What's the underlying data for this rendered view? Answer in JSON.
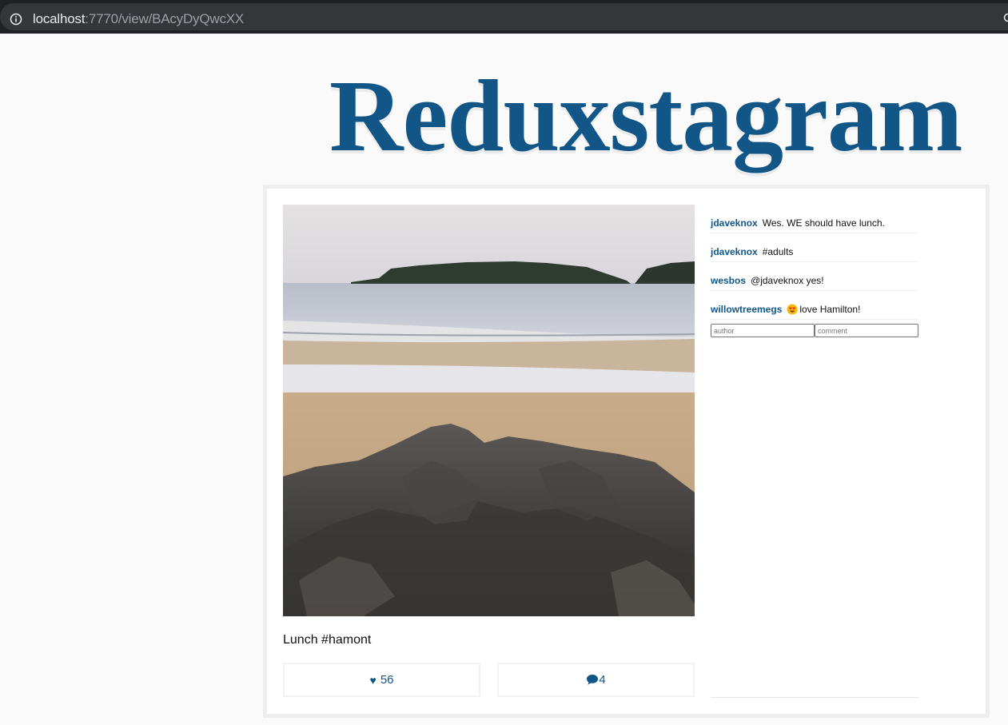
{
  "browser": {
    "url_host": "localhost",
    "url_path": ":7770/view/BAcyDyQwcXX",
    "icon": "info-icon"
  },
  "page": {
    "title": "Reduxstagram",
    "title_color": "#125688"
  },
  "post": {
    "caption": "Lunch #hamont",
    "likes": "56",
    "comments_count": "4",
    "like_icon": "♥",
    "comment_icon": "speech-bubble-icon"
  },
  "comments": [
    {
      "user": "jdaveknox",
      "text": "Wes. WE should have lunch."
    },
    {
      "user": "jdaveknox",
      "text": "#adults"
    },
    {
      "user": "wesbos",
      "text": "@jdaveknox yes!"
    },
    {
      "user": "willowtreemegs",
      "emoji": "heart-eyes-emoji",
      "text": "love Hamilton!"
    }
  ],
  "comment_form": {
    "author_placeholder": "author",
    "comment_placeholder": "comment"
  }
}
